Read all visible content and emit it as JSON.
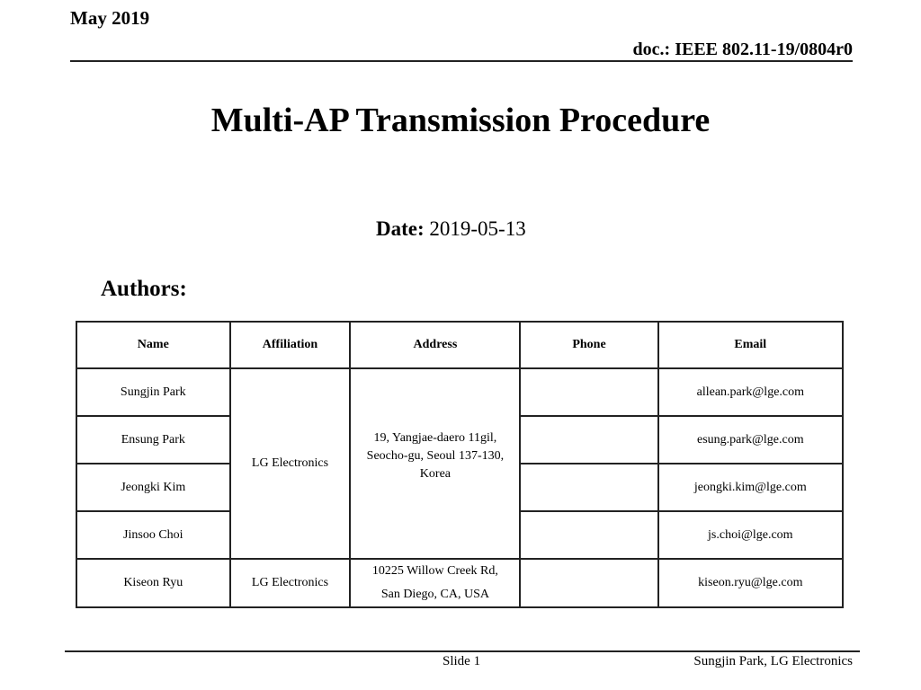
{
  "header": {
    "date_label": "May 2019",
    "doc_id": "doc.: IEEE 802.11-19/0804r0"
  },
  "title": "Multi-AP Transmission Procedure",
  "date": {
    "label": "Date:",
    "value": "2019-05-13"
  },
  "authors_heading": "Authors:",
  "table": {
    "columns": [
      "Name",
      "Affiliation",
      "Address",
      "Phone",
      "Email"
    ],
    "rows": [
      {
        "name": "Sungjin Park",
        "phone": "",
        "email": "allean.park@lge.com"
      },
      {
        "name": "Ensung Park",
        "phone": "",
        "email": "esung.park@lge.com"
      },
      {
        "name": "Jeongki Kim",
        "phone": "",
        "email": "jeongki.kim@lge.com"
      },
      {
        "name": "Jinsoo Choi",
        "phone": "",
        "email": "js.choi@lge.com"
      },
      {
        "name": "Kiseon Ryu",
        "affiliation": "LG Electronics",
        "address_line1": "10225 Willow Creek Rd,",
        "address_line2": "San Diego, CA, USA",
        "phone": "",
        "email": "kiseon.ryu@lge.com"
      }
    ],
    "merged": {
      "affiliation": "LG Electronics",
      "address": "19, Yangjae-daero 11gil, Seocho-gu, Seoul 137-130, Korea"
    }
  },
  "footer": {
    "slide": "Slide 1",
    "author": "Sungjin Park, LG Electronics"
  }
}
